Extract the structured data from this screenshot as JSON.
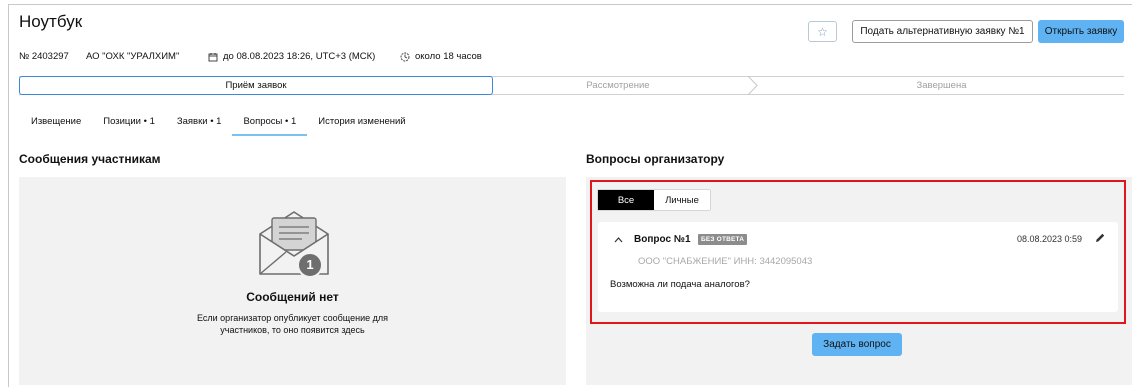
{
  "page": {
    "title": "Ноутбук"
  },
  "header": {
    "favorite_icon": "star-outline-icon",
    "alt_request_label": "Подать альтернативную заявку №1",
    "open_request_label": "Открыть заявку"
  },
  "meta": {
    "number": "№ 2403297",
    "organization": "АО \"ОХК \"УРАЛХИМ\"",
    "deadline": "до 08.08.2023 18:26, UTC+3 (МСК)",
    "remaining": "около 18 часов"
  },
  "stages": [
    {
      "label": "Приём заявок",
      "active": true
    },
    {
      "label": "Рассмотрение",
      "active": false
    },
    {
      "label": "Завершена",
      "active": false
    }
  ],
  "tabs": [
    {
      "label": "Извещение"
    },
    {
      "label": "Позиции • 1"
    },
    {
      "label": "Заявки • 1"
    },
    {
      "label": "Вопросы • 1",
      "active": true
    },
    {
      "label": "История изменений"
    }
  ],
  "messages": {
    "title": "Сообщения участникам",
    "count_badge": "1",
    "empty_title": "Сообщений нет",
    "empty_line1": "Если организатор опубликует сообщение для",
    "empty_line2": "участников, то оно появится здесь"
  },
  "questions": {
    "title": "Вопросы организатору",
    "filters": [
      {
        "label": "Все",
        "selected": true
      },
      {
        "label": "Личные",
        "selected": false
      }
    ],
    "items": [
      {
        "title": "Вопрос №1",
        "badge": "БЕЗ ОТВЕТА",
        "date": "08.08.2023 0:59",
        "author": "ООО \"СНАБЖЕНИЕ\" ИНН: 3442095043",
        "text": "Возможна ли подача аналогов?"
      }
    ],
    "ask_label": "Задать вопрос"
  },
  "colors": {
    "accent_blue": "#5fb3f2",
    "stage_border": "#3b87d9",
    "highlight_red": "#e0161b",
    "panel_bg": "#f2f2f2"
  }
}
